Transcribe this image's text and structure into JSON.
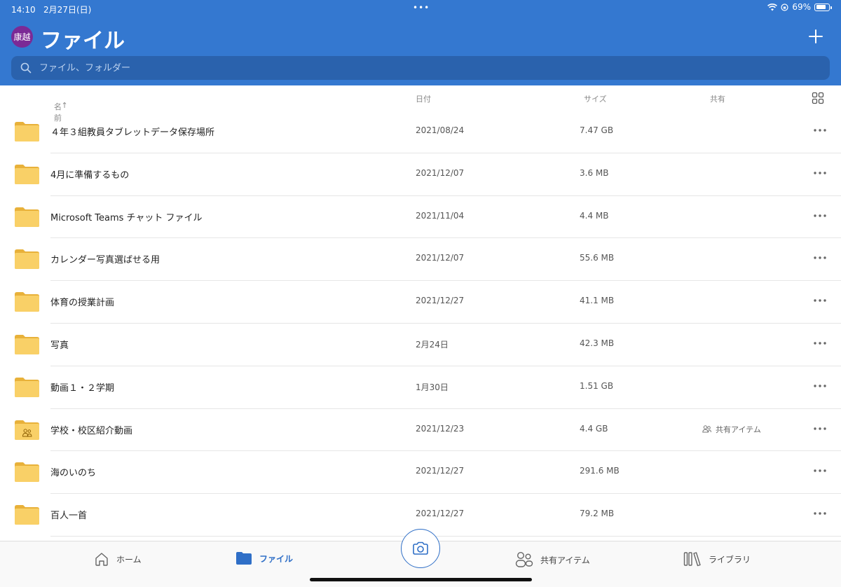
{
  "status": {
    "time": "14:10",
    "date": "2月27日(日)",
    "battery": "69%"
  },
  "header": {
    "avatar": "康越",
    "title": "ファイル"
  },
  "search": {
    "placeholder": "ファイル、フォルダー"
  },
  "columns": {
    "name": "名前",
    "sort_arrow": "↑",
    "date": "日付",
    "size": "サイズ",
    "shared": "共有"
  },
  "files": [
    {
      "name": "４年３組教員タブレットデータ保存場所",
      "date": "2021/08/24",
      "size": "7.47 GB",
      "shared": ""
    },
    {
      "name": "4月に準備するもの",
      "date": "2021/12/07",
      "size": "3.6 MB",
      "shared": ""
    },
    {
      "name": "Microsoft Teams チャット ファイル",
      "date": "2021/11/04",
      "size": "4.4 MB",
      "shared": ""
    },
    {
      "name": "カレンダー写真選ばせる用",
      "date": "2021/12/07",
      "size": "55.6 MB",
      "shared": ""
    },
    {
      "name": "体育の授業計画",
      "date": "2021/12/27",
      "size": "41.1 MB",
      "shared": ""
    },
    {
      "name": "写真",
      "date": "2月24日",
      "size": "42.3 MB",
      "shared": ""
    },
    {
      "name": "動画１・２学期",
      "date": "1月30日",
      "size": "1.51 GB",
      "shared": ""
    },
    {
      "name": "学校・校区紹介動画",
      "date": "2021/12/23",
      "size": "4.4 GB",
      "shared": "共有アイテム"
    },
    {
      "name": "海のいのち",
      "date": "2021/12/27",
      "size": "291.6 MB",
      "shared": ""
    },
    {
      "name": "百人一首",
      "date": "2021/12/27",
      "size": "79.2 MB",
      "shared": ""
    }
  ],
  "tabs": {
    "home": "ホーム",
    "files": "ファイル",
    "shared": "共有アイテム",
    "library": "ライブラリ"
  },
  "colors": {
    "accent": "#3478d0",
    "folder": "#f7c948",
    "avatar": "#7b2a96"
  }
}
